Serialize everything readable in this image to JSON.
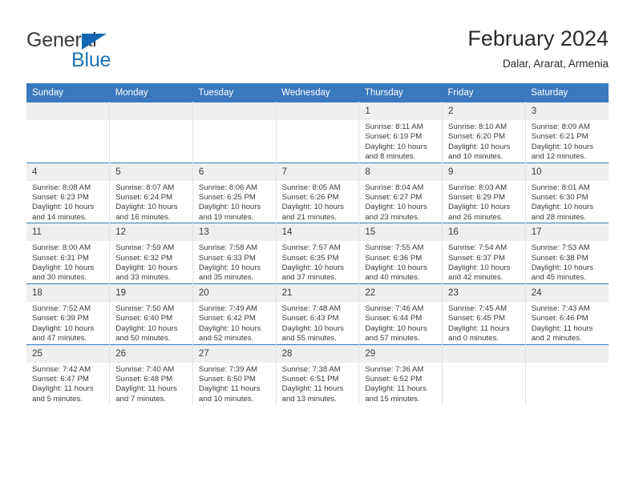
{
  "logo": {
    "word_one": "General",
    "word_two": "Blue",
    "triangle_color": "#1267b2",
    "blue_color": "#1b75bc"
  },
  "header": {
    "title": "February 2024",
    "subtitle": "Dalar, Ararat, Armenia"
  },
  "theme": {
    "header_row_bg": "#3a79bd",
    "daynum_bg": "#efefef",
    "cell_border": "#e3e3e3",
    "text": "#3b3b3b"
  },
  "weekday_headers": [
    "Sunday",
    "Monday",
    "Tuesday",
    "Wednesday",
    "Thursday",
    "Friday",
    "Saturday"
  ],
  "weeks": [
    [
      {
        "day": "",
        "empty": true
      },
      {
        "day": "",
        "empty": true
      },
      {
        "day": "",
        "empty": true
      },
      {
        "day": "",
        "empty": true
      },
      {
        "day": "1",
        "sunrise": "Sunrise: 8:11 AM",
        "sunset": "Sunset: 6:19 PM",
        "daylight_line1": "Daylight: 10 hours",
        "daylight_line2": "and 8 minutes."
      },
      {
        "day": "2",
        "sunrise": "Sunrise: 8:10 AM",
        "sunset": "Sunset: 6:20 PM",
        "daylight_line1": "Daylight: 10 hours",
        "daylight_line2": "and 10 minutes."
      },
      {
        "day": "3",
        "sunrise": "Sunrise: 8:09 AM",
        "sunset": "Sunset: 6:21 PM",
        "daylight_line1": "Daylight: 10 hours",
        "daylight_line2": "and 12 minutes."
      }
    ],
    [
      {
        "day": "4",
        "sunrise": "Sunrise: 8:08 AM",
        "sunset": "Sunset: 6:23 PM",
        "daylight_line1": "Daylight: 10 hours",
        "daylight_line2": "and 14 minutes."
      },
      {
        "day": "5",
        "sunrise": "Sunrise: 8:07 AM",
        "sunset": "Sunset: 6:24 PM",
        "daylight_line1": "Daylight: 10 hours",
        "daylight_line2": "and 16 minutes."
      },
      {
        "day": "6",
        "sunrise": "Sunrise: 8:06 AM",
        "sunset": "Sunset: 6:25 PM",
        "daylight_line1": "Daylight: 10 hours",
        "daylight_line2": "and 19 minutes."
      },
      {
        "day": "7",
        "sunrise": "Sunrise: 8:05 AM",
        "sunset": "Sunset: 6:26 PM",
        "daylight_line1": "Daylight: 10 hours",
        "daylight_line2": "and 21 minutes."
      },
      {
        "day": "8",
        "sunrise": "Sunrise: 8:04 AM",
        "sunset": "Sunset: 6:27 PM",
        "daylight_line1": "Daylight: 10 hours",
        "daylight_line2": "and 23 minutes."
      },
      {
        "day": "9",
        "sunrise": "Sunrise: 8:03 AM",
        "sunset": "Sunset: 6:29 PM",
        "daylight_line1": "Daylight: 10 hours",
        "daylight_line2": "and 26 minutes."
      },
      {
        "day": "10",
        "sunrise": "Sunrise: 8:01 AM",
        "sunset": "Sunset: 6:30 PM",
        "daylight_line1": "Daylight: 10 hours",
        "daylight_line2": "and 28 minutes."
      }
    ],
    [
      {
        "day": "11",
        "sunrise": "Sunrise: 8:00 AM",
        "sunset": "Sunset: 6:31 PM",
        "daylight_line1": "Daylight: 10 hours",
        "daylight_line2": "and 30 minutes."
      },
      {
        "day": "12",
        "sunrise": "Sunrise: 7:59 AM",
        "sunset": "Sunset: 6:32 PM",
        "daylight_line1": "Daylight: 10 hours",
        "daylight_line2": "and 33 minutes."
      },
      {
        "day": "13",
        "sunrise": "Sunrise: 7:58 AM",
        "sunset": "Sunset: 6:33 PM",
        "daylight_line1": "Daylight: 10 hours",
        "daylight_line2": "and 35 minutes."
      },
      {
        "day": "14",
        "sunrise": "Sunrise: 7:57 AM",
        "sunset": "Sunset: 6:35 PM",
        "daylight_line1": "Daylight: 10 hours",
        "daylight_line2": "and 37 minutes."
      },
      {
        "day": "15",
        "sunrise": "Sunrise: 7:55 AM",
        "sunset": "Sunset: 6:36 PM",
        "daylight_line1": "Daylight: 10 hours",
        "daylight_line2": "and 40 minutes."
      },
      {
        "day": "16",
        "sunrise": "Sunrise: 7:54 AM",
        "sunset": "Sunset: 6:37 PM",
        "daylight_line1": "Daylight: 10 hours",
        "daylight_line2": "and 42 minutes."
      },
      {
        "day": "17",
        "sunrise": "Sunrise: 7:53 AM",
        "sunset": "Sunset: 6:38 PM",
        "daylight_line1": "Daylight: 10 hours",
        "daylight_line2": "and 45 minutes."
      }
    ],
    [
      {
        "day": "18",
        "sunrise": "Sunrise: 7:52 AM",
        "sunset": "Sunset: 6:39 PM",
        "daylight_line1": "Daylight: 10 hours",
        "daylight_line2": "and 47 minutes."
      },
      {
        "day": "19",
        "sunrise": "Sunrise: 7:50 AM",
        "sunset": "Sunset: 6:40 PM",
        "daylight_line1": "Daylight: 10 hours",
        "daylight_line2": "and 50 minutes."
      },
      {
        "day": "20",
        "sunrise": "Sunrise: 7:49 AM",
        "sunset": "Sunset: 6:42 PM",
        "daylight_line1": "Daylight: 10 hours",
        "daylight_line2": "and 52 minutes."
      },
      {
        "day": "21",
        "sunrise": "Sunrise: 7:48 AM",
        "sunset": "Sunset: 6:43 PM",
        "daylight_line1": "Daylight: 10 hours",
        "daylight_line2": "and 55 minutes."
      },
      {
        "day": "22",
        "sunrise": "Sunrise: 7:46 AM",
        "sunset": "Sunset: 6:44 PM",
        "daylight_line1": "Daylight: 10 hours",
        "daylight_line2": "and 57 minutes."
      },
      {
        "day": "23",
        "sunrise": "Sunrise: 7:45 AM",
        "sunset": "Sunset: 6:45 PM",
        "daylight_line1": "Daylight: 11 hours",
        "daylight_line2": "and 0 minutes."
      },
      {
        "day": "24",
        "sunrise": "Sunrise: 7:43 AM",
        "sunset": "Sunset: 6:46 PM",
        "daylight_line1": "Daylight: 11 hours",
        "daylight_line2": "and 2 minutes."
      }
    ],
    [
      {
        "day": "25",
        "sunrise": "Sunrise: 7:42 AM",
        "sunset": "Sunset: 6:47 PM",
        "daylight_line1": "Daylight: 11 hours",
        "daylight_line2": "and 5 minutes."
      },
      {
        "day": "26",
        "sunrise": "Sunrise: 7:40 AM",
        "sunset": "Sunset: 6:48 PM",
        "daylight_line1": "Daylight: 11 hours",
        "daylight_line2": "and 7 minutes."
      },
      {
        "day": "27",
        "sunrise": "Sunrise: 7:39 AM",
        "sunset": "Sunset: 6:50 PM",
        "daylight_line1": "Daylight: 11 hours",
        "daylight_line2": "and 10 minutes."
      },
      {
        "day": "28",
        "sunrise": "Sunrise: 7:38 AM",
        "sunset": "Sunset: 6:51 PM",
        "daylight_line1": "Daylight: 11 hours",
        "daylight_line2": "and 13 minutes."
      },
      {
        "day": "29",
        "sunrise": "Sunrise: 7:36 AM",
        "sunset": "Sunset: 6:52 PM",
        "daylight_line1": "Daylight: 11 hours",
        "daylight_line2": "and 15 minutes."
      },
      {
        "day": "",
        "empty": true
      },
      {
        "day": "",
        "empty": true
      }
    ]
  ]
}
